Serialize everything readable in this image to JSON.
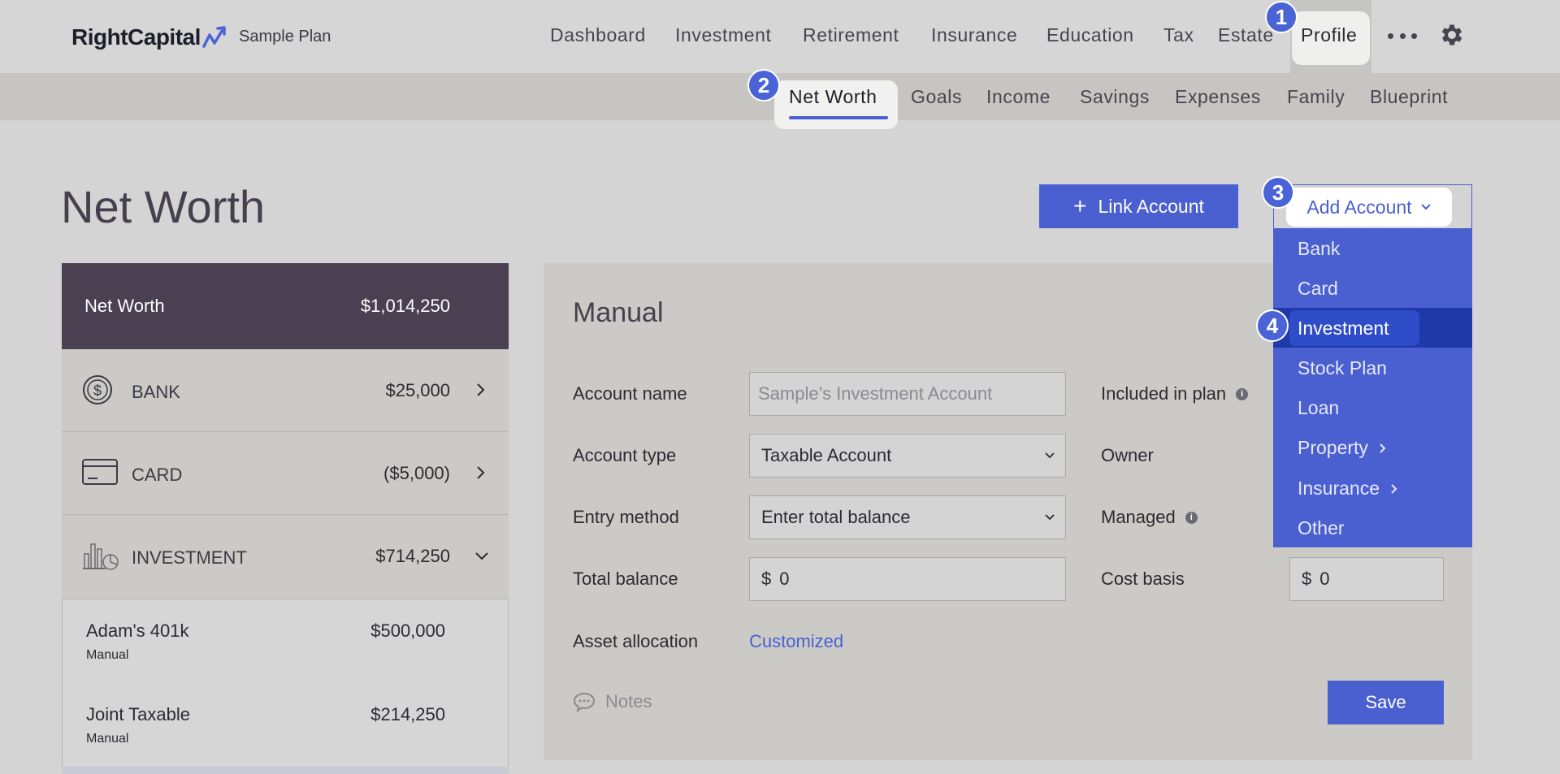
{
  "brand": {
    "name": "RightCapital",
    "plan": "Sample Plan"
  },
  "nav": {
    "items": [
      "Dashboard",
      "Investment",
      "Retirement",
      "Insurance",
      "Education",
      "Tax",
      "Estate",
      "Profile"
    ],
    "active": "Profile"
  },
  "subnav": {
    "items": [
      "Net Worth",
      "Goals",
      "Income",
      "Savings",
      "Expenses",
      "Family",
      "Blueprint"
    ],
    "active": "Net Worth"
  },
  "badges": [
    "1",
    "2",
    "3",
    "4"
  ],
  "page": {
    "title": "Net Worth"
  },
  "actions": {
    "link_account": "Link Account",
    "add_account": "Add Account"
  },
  "add_menu": {
    "items": [
      "Bank",
      "Card",
      "Investment",
      "Stock Plan",
      "Loan",
      "Property",
      "Insurance",
      "Other"
    ],
    "highlighted": "Investment",
    "submenu_items": [
      "Property",
      "Insurance"
    ]
  },
  "net_worth": {
    "label": "Net Worth",
    "value": "$1,014,250",
    "categories": [
      {
        "label": "BANK",
        "value": "$25,000",
        "icon": "dollar-coin-icon"
      },
      {
        "label": "CARD",
        "value": "($5,000)",
        "icon": "credit-card-icon"
      },
      {
        "label": "INVESTMENT",
        "value": "$714,250",
        "icon": "investment-chart-icon"
      }
    ],
    "accounts": [
      {
        "name": "Adam's 401k",
        "type": "Manual",
        "value": "$500,000"
      },
      {
        "name": "Joint Taxable",
        "type": "Manual",
        "value": "$214,250"
      }
    ]
  },
  "form": {
    "title": "Manual",
    "account_name_label": "Account name",
    "account_name_placeholder": "Sample’s Investment Account",
    "account_type_label": "Account type",
    "account_type_value": "Taxable Account",
    "entry_method_label": "Entry method",
    "entry_method_value": "Enter total balance",
    "total_balance_label": "Total balance",
    "total_balance_currency": "$",
    "total_balance_value": "0",
    "asset_allocation_label": "Asset allocation",
    "asset_allocation_value": "Customized",
    "included_label": "Included in plan",
    "owner_label": "Owner",
    "managed_label": "Managed",
    "cost_basis_label": "Cost basis",
    "cost_basis_currency": "$",
    "cost_basis_value": "0",
    "notes_label": "Notes",
    "save_label": "Save"
  },
  "colors": {
    "accent": "#4a5fd0",
    "header_dark": "#4b3f52",
    "menu_highlight": "#1f3aa8"
  }
}
